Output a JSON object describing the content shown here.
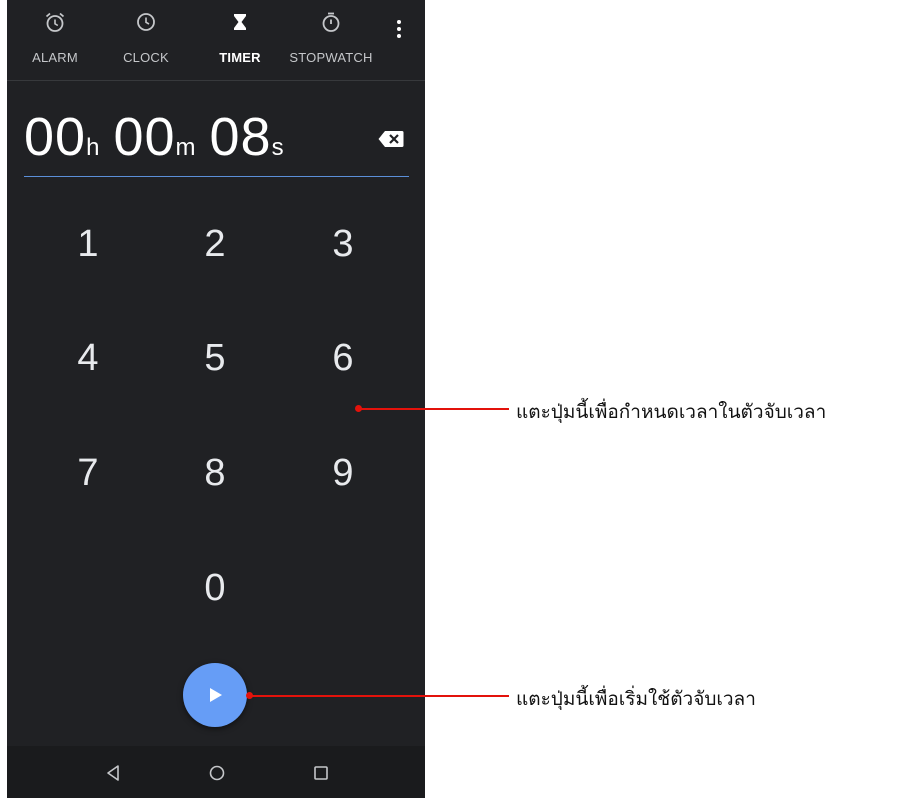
{
  "tabs": [
    {
      "label": "ALARM",
      "icon": "alarm-icon"
    },
    {
      "label": "CLOCK",
      "icon": "clock-icon"
    },
    {
      "label": "TIMER",
      "icon": "hourglass-icon",
      "active": true
    },
    {
      "label": "STOPWATCH",
      "icon": "stopwatch-icon"
    }
  ],
  "timer": {
    "hours": "00",
    "hours_unit": "h",
    "minutes": "00",
    "minutes_unit": "m",
    "seconds": "08",
    "seconds_unit": "s"
  },
  "keypad": [
    "1",
    "2",
    "3",
    "4",
    "5",
    "6",
    "7",
    "8",
    "9",
    "0"
  ],
  "callouts": {
    "keypad": "แตะปุ่มนี้เพื่อกำหนดเวลาในตัวจับเวลา",
    "start": "แตะปุ่มนี้เพื่อเริ่มใช้ตัวจับเวลา"
  },
  "colors": {
    "background": "#202124",
    "accent": "#669df6",
    "callout": "#e3120b"
  }
}
